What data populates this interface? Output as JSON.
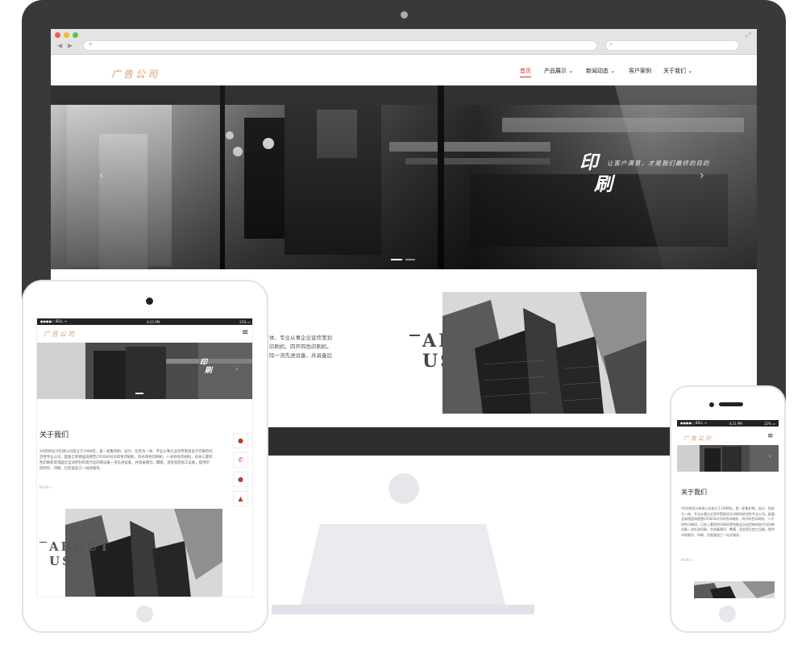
{
  "site": {
    "logo": "广告公司",
    "nav": [
      "首页",
      "产品展示",
      "新闻动态",
      "客户案例",
      "关于我们"
    ],
    "hero_title_1": "印",
    "hero_title_2": "刷",
    "hero_subtitle": "让客户满意，才是我们最终的目的",
    "about_title": "关于我们",
    "about_body": "XX印刷设计有限公司成立于1998年，是一家集印刷、设计、包装为一体、专业从事企业宣传策划设计印刷的综合性专业公司。配备全新德国海德堡CP2000对开四色印刷机、四开四色印刷机、八开四色印刷机，日本三菱四色印刷机等电脑全自动控制的现代化印刷设备一流先进设备，并具备模切、覆膜、烫金等后加工设备，提供印前制作、印刷、包装盒加工一站式服务。",
    "about_partial_lines": [
      "体、专业从事企业宣传策划",
      "印刷机、四开四色印刷机、",
      "际一流先进设备，并具备后"
    ],
    "about_en_1": "ABOUT",
    "about_en_2": "US",
    "more": "MORE →"
  },
  "status_bar": {
    "carrier": "●●●●○ BELL ᯤ",
    "time": "4:21 PM",
    "battery": "22%"
  },
  "colors": {
    "accent": "#c0392b",
    "logo": "#d89a6a",
    "frame": "#393939"
  }
}
